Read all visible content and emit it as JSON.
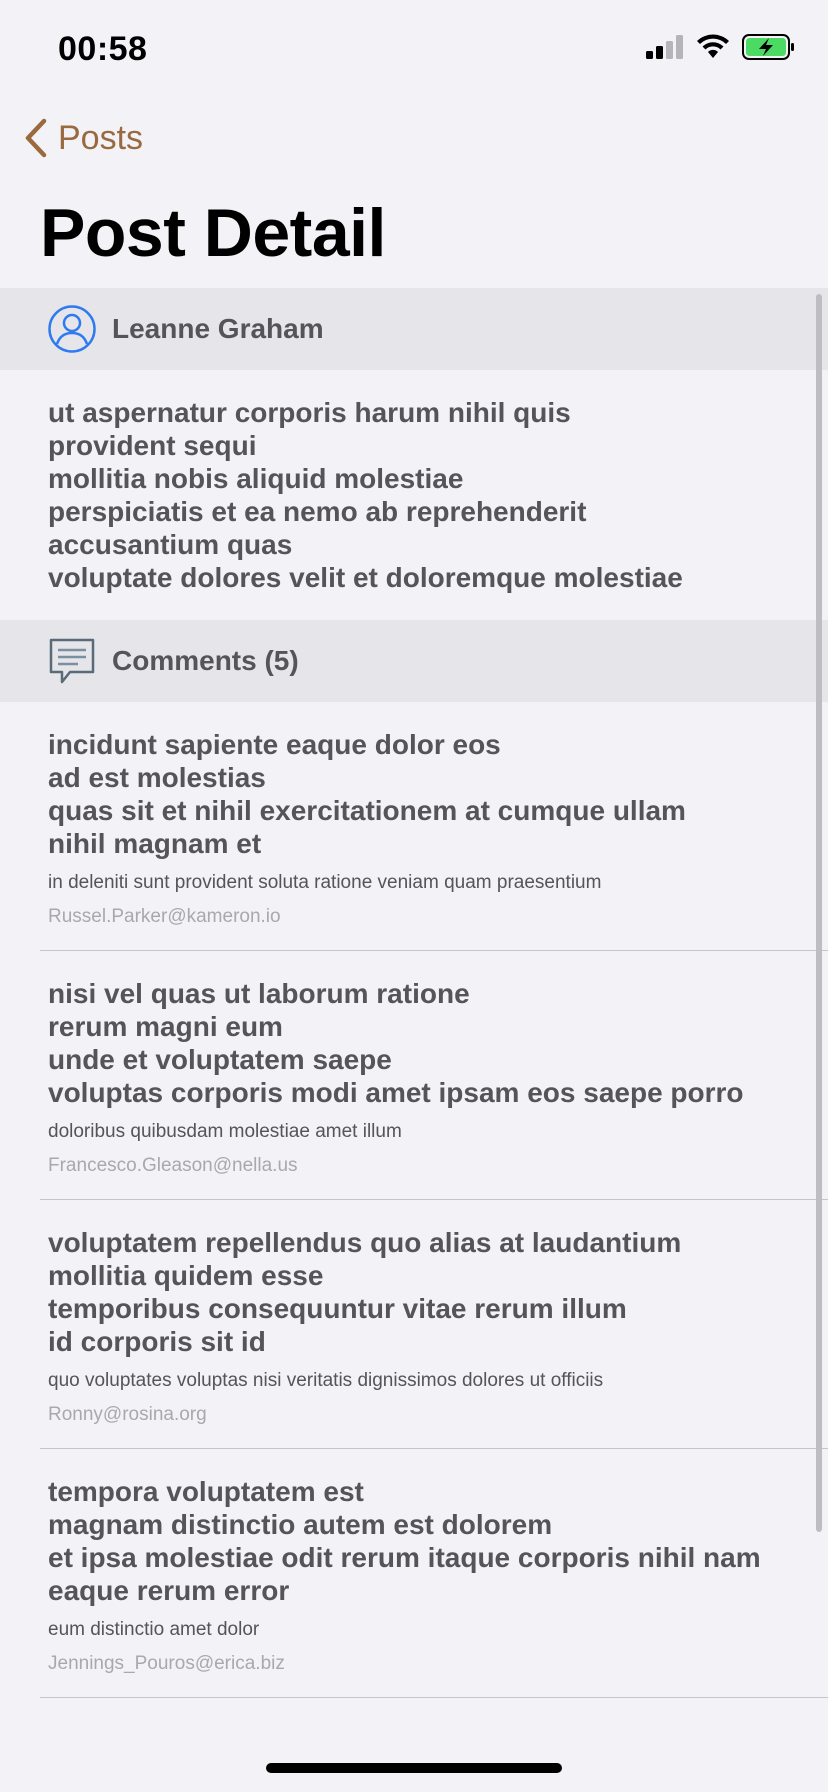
{
  "status_bar": {
    "time": "00:58",
    "icons": [
      "cellular-signal-icon",
      "wifi-icon",
      "battery-charging-icon"
    ],
    "battery_color": "#4cd964"
  },
  "nav": {
    "back_label": "Posts",
    "title": "Post Detail",
    "accent_color": "#9a6a3e"
  },
  "author": {
    "name": "Leanne Graham",
    "icon": "person-circle-icon"
  },
  "post": {
    "body_lines": [
      "ut aspernatur corporis harum nihil quis",
      "provident sequi",
      "mollitia nobis aliquid molestiae",
      "perspiciatis et ea nemo ab reprehenderit",
      "accusantium quas",
      "voluptate dolores velit et doloremque molestiae"
    ]
  },
  "comments_section": {
    "label": "Comments (5)",
    "icon": "comment-bubble-icon"
  },
  "comments": [
    {
      "title_lines": [
        "incidunt sapiente eaque dolor eos",
        "ad est molestias",
        "quas sit et nihil exercitationem at cumque ullam",
        "nihil magnam et"
      ],
      "body": "in deleniti sunt provident soluta ratione veniam quam praesentium",
      "email": "Russel.Parker@kameron.io"
    },
    {
      "title_lines": [
        "nisi vel quas ut laborum ratione",
        "rerum magni eum",
        "unde et voluptatem saepe",
        "voluptas corporis modi amet ipsam eos saepe porro"
      ],
      "body": "doloribus quibusdam molestiae amet illum",
      "email": "Francesco.Gleason@nella.us"
    },
    {
      "title_lines": [
        "voluptatem repellendus quo alias at laudantium",
        "mollitia quidem esse",
        "temporibus consequuntur vitae rerum illum",
        "id corporis sit id"
      ],
      "body": "quo voluptates voluptas nisi veritatis dignissimos dolores ut officiis",
      "email": "Ronny@rosina.org"
    },
    {
      "title_lines": [
        "tempora voluptatem est",
        "magnam distinctio autem est dolorem",
        "et ipsa molestiae odit rerum itaque corporis nihil nam",
        "eaque rerum error"
      ],
      "body": "eum distinctio amet dolor",
      "email": "Jennings_Pouros@erica.biz"
    }
  ]
}
